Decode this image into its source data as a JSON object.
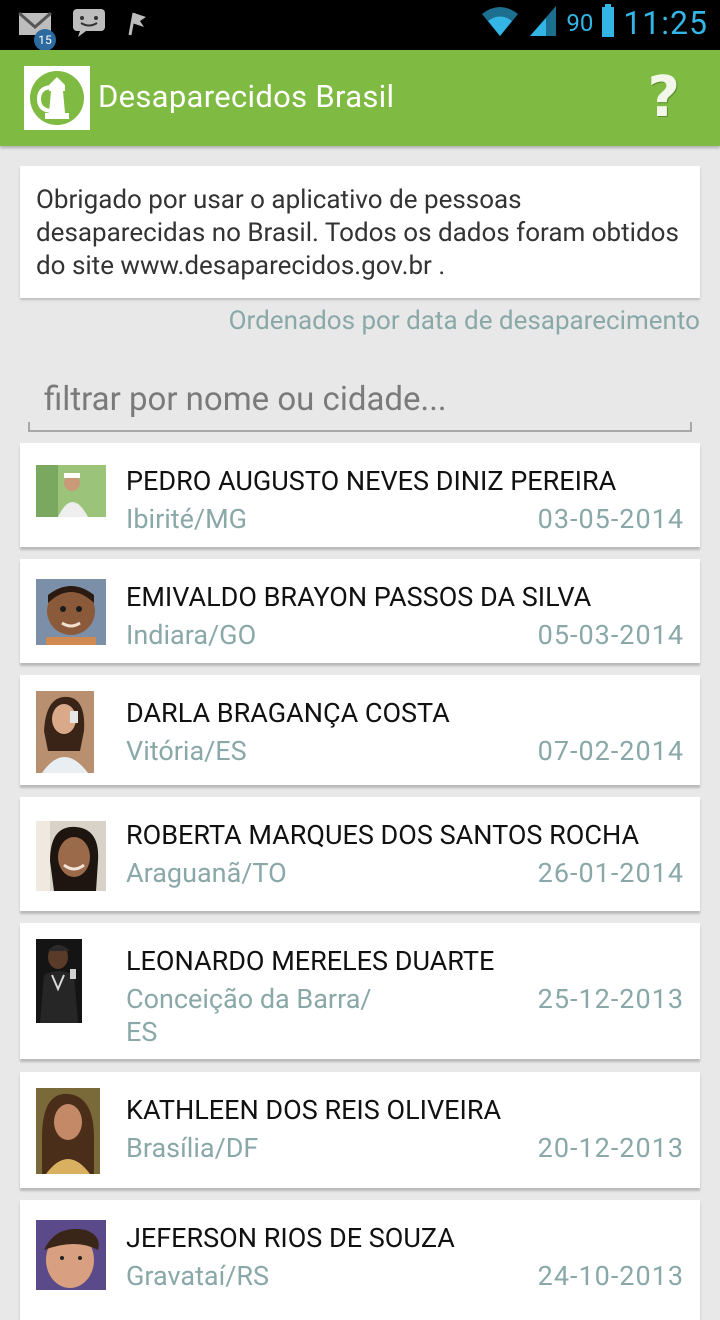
{
  "status_bar": {
    "notification_count": "15",
    "battery_percent": "90",
    "time": "11:25",
    "icons": [
      "gmail-icon",
      "chat-icon",
      "flag-icon",
      "wifi-icon",
      "signal-icon",
      "battery-icon"
    ]
  },
  "action_bar": {
    "title": "Desaparecidos Brasil",
    "help_label": "?"
  },
  "intro": {
    "text": "Obrigado por usar o aplicativo de pessoas desaparecidas no Brasil. Todos os dados foram obtidos do site www.desaparecidos.gov.br ."
  },
  "sort_note": "Ordenados por data de desaparecimento",
  "search": {
    "placeholder": "filtrar por nome ou cidade...",
    "value": ""
  },
  "people": [
    {
      "name": "PEDRO AUGUSTO NEVES DINIZ PEREIRA",
      "city": "Ibirité/MG",
      "date": "03-05-2014"
    },
    {
      "name": "EMIVALDO BRAYON PASSOS DA SILVA",
      "city": "Indiara/GO",
      "date": "05-03-2014"
    },
    {
      "name": "DARLA BRAGANÇA COSTA",
      "city": "Vitória/ES",
      "date": "07-02-2014"
    },
    {
      "name": "ROBERTA MARQUES DOS SANTOS ROCHA",
      "city": "Araguanã/TO",
      "date": "26-01-2014"
    },
    {
      "name": "LEONARDO MERELES DUARTE",
      "city": "Conceição da Barra/ ES",
      "date": "25-12-2013"
    },
    {
      "name": "KATHLEEN DOS REIS OLIVEIRA",
      "city": "Brasília/DF",
      "date": "20-12-2013"
    },
    {
      "name": "JEFERSON RIOS DE SOUZA",
      "city": "Gravataí/RS",
      "date": "24-10-2013"
    }
  ],
  "colors": {
    "action_bar": "#7fba42",
    "accent_text": "#8aa8a8",
    "status_blue": "#33b5e5"
  }
}
